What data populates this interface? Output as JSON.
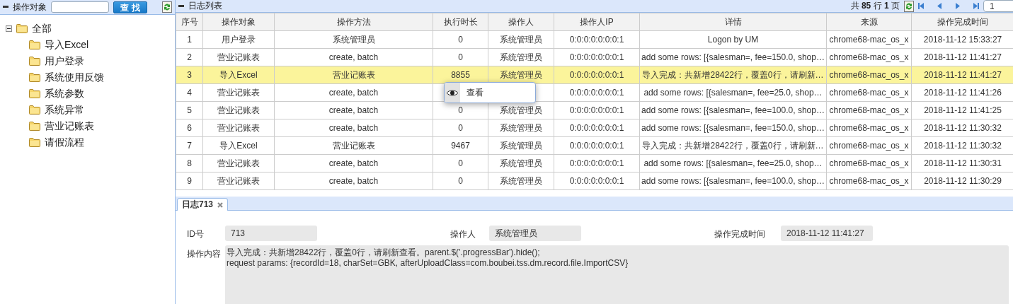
{
  "left_panel": {
    "title": "操作对象",
    "search_button": "查 找",
    "tree": {
      "label": "全部",
      "expanded": true,
      "children": [
        {
          "label": "导入Excel"
        },
        {
          "label": "用户登录"
        },
        {
          "label": "系统使用反馈"
        },
        {
          "label": "系统参数"
        },
        {
          "label": "系统异常"
        },
        {
          "label": "营业记账表"
        },
        {
          "label": "请假流程"
        }
      ]
    }
  },
  "log_list": {
    "title": "日志列表",
    "pagination": {
      "summary": "共 **85** 行 **1** 页",
      "page": "1"
    },
    "columns": [
      "序号",
      "操作对象",
      "操作方法",
      "执行时长",
      "操作人",
      "操作人IP",
      "详情",
      "来源",
      "操作完成时间"
    ],
    "rows": [
      {
        "selected": false,
        "cells": [
          "1",
          "用户登录",
          "系统管理员",
          "0",
          "系统管理员",
          "0:0:0:0:0:0:0:1",
          "Logon by UM",
          "chrome68-mac_os_x",
          "2018-11-12 15:33:27"
        ]
      },
      {
        "selected": false,
        "cells": [
          "2",
          "营业记账表",
          "create, batch",
          "0",
          "系统管理员",
          "0:0:0:0:0:0:0:1",
          "add some rows: [{salesman=, fee=150.0, shop…",
          "chrome68-mac_os_x",
          "2018-11-12 11:41:27"
        ]
      },
      {
        "selected": true,
        "cells": [
          "3",
          "导入Excel",
          "营业记账表",
          "8855",
          "系统管理员",
          "0:0:0:0:0:0:0:1",
          "导入完成：共新增28422行，覆盖0行，请刷新…",
          "chrome68-mac_os_x",
          "2018-11-12 11:41:27"
        ]
      },
      {
        "selected": false,
        "cells": [
          "4",
          "营业记账表",
          "create, batch",
          null,
          null,
          "0:0:0:0:0:0:0:1",
          "add some rows: [{salesman=, fee=25.0, shop…",
          "chrome68-mac_os_x",
          "2018-11-12 11:41:26"
        ]
      },
      {
        "selected": false,
        "cells": [
          "5",
          "营业记账表",
          "create, batch",
          "0",
          "系统管理员",
          "0:0:0:0:0:0:0:1",
          "add some rows: [{salesman=, fee=100.0, shop…",
          "chrome68-mac_os_x",
          "2018-11-12 11:41:25"
        ]
      },
      {
        "selected": false,
        "cells": [
          "6",
          "营业记账表",
          "create, batch",
          "0",
          "系统管理员",
          "0:0:0:0:0:0:0:1",
          "add some rows: [{salesman=, fee=150.0, shop…",
          "chrome68-mac_os_x",
          "2018-11-12 11:30:32"
        ]
      },
      {
        "selected": false,
        "cells": [
          "7",
          "导入Excel",
          "营业记账表",
          "9467",
          "系统管理员",
          "0:0:0:0:0:0:0:1",
          "导入完成：共新增28422行，覆盖0行，请刷新…",
          "chrome68-mac_os_x",
          "2018-11-12 11:30:32"
        ]
      },
      {
        "selected": false,
        "cells": [
          "8",
          "营业记账表",
          "create, batch",
          "0",
          "系统管理员",
          "0:0:0:0:0:0:0:1",
          "add some rows: [{salesman=, fee=25.0, shop…",
          "chrome68-mac_os_x",
          "2018-11-12 11:30:31"
        ]
      },
      {
        "selected": false,
        "cells": [
          "9",
          "营业记账表",
          "create, batch",
          "0",
          "系统管理员",
          "0:0:0:0:0:0:0:1",
          "add some rows: [{salesman=, fee=100.0, shop…",
          "chrome68-mac_os_x",
          "2018-11-12 11:30:29"
        ]
      }
    ]
  },
  "context_menu": {
    "items": [
      {
        "label": "查看"
      }
    ]
  },
  "detail": {
    "tab": {
      "label": "日志713",
      "selected": true
    },
    "fields": [
      {
        "label": "ID号",
        "value": "713"
      },
      {
        "label": "操作人",
        "value": "系统管理员"
      },
      {
        "label": "操作完成时间",
        "value": "2018-11-12 11:41:27"
      }
    ],
    "content": {
      "label": "操作内容",
      "lines": [
        "导入完成：共新增28422行，覆盖0行，请刷新查看。parent.$('.progressBar').hide();",
        "request params: {recordId=18, charSet=GBK, afterUploadClass=com.boubei.tss.dm.record.file.ImportCSV}"
      ]
    }
  }
}
